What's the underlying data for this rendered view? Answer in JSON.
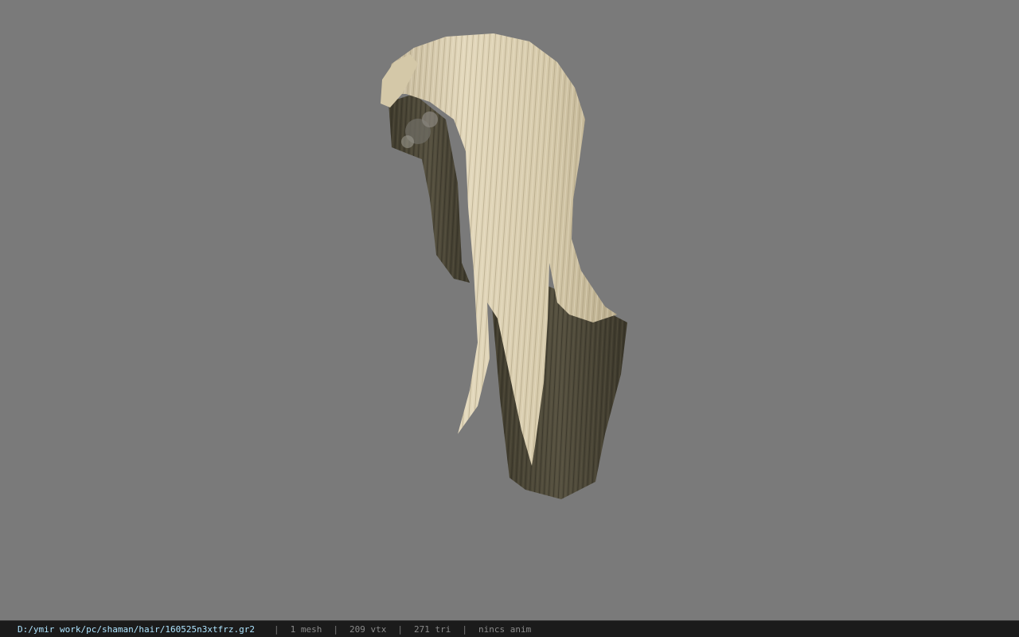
{
  "viewer": {
    "background_color": "#7a7a7a",
    "model_icon": "hair-mesh-3d-preview"
  },
  "status_bar": {
    "file_path": "D:/ymir work/pc/shaman/hair/160525n3xtfrz.gr2",
    "separator": "|",
    "mesh_count": "1 mesh",
    "vertex_count": "209 vtx",
    "triangle_count": "271 tri",
    "animation": "nincs anim"
  },
  "colors": {
    "hair_light": "#d9cdb0",
    "hair_shadow": "#4a4636",
    "status_path": "#aee4ff",
    "status_text": "#8a8a8a",
    "status_bg": "#1b1b1b"
  }
}
